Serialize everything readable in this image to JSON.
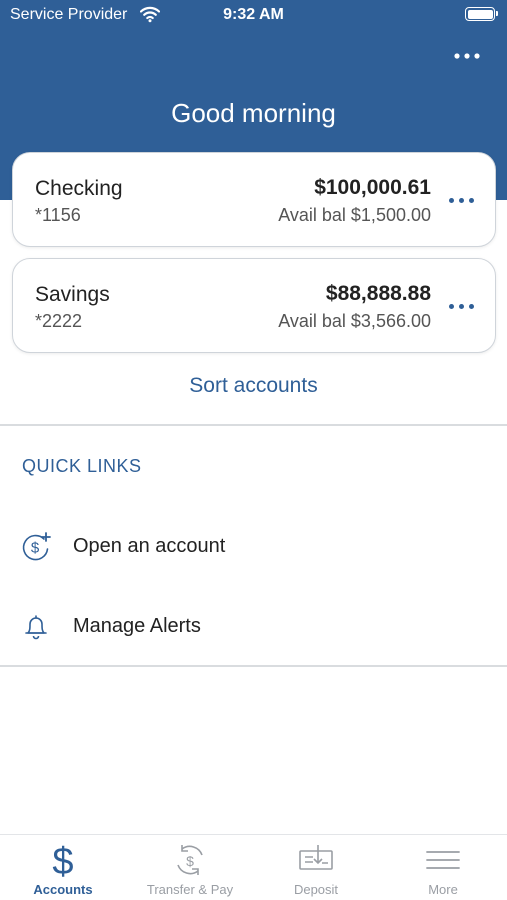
{
  "status_bar": {
    "carrier": "Service Provider",
    "time": "9:32 AM"
  },
  "header": {
    "greeting": "Good morning"
  },
  "accounts": [
    {
      "name": "Checking",
      "number": "*1156",
      "balance": "$100,000.61",
      "avail": "Avail bal $1,500.00"
    },
    {
      "name": "Savings",
      "number": "*2222",
      "balance": "$88,888.88",
      "avail": "Avail bal $3,566.00"
    }
  ],
  "sort_label": "Sort accounts",
  "quick_links": {
    "title": "QUICK LINKS",
    "items": [
      {
        "label": "Open an account",
        "icon": "dollar-plus-icon"
      },
      {
        "label": "Manage Alerts",
        "icon": "bell-icon"
      }
    ]
  },
  "tab_bar": {
    "tabs": [
      {
        "label": "Accounts",
        "icon": "dollar-icon",
        "active": true
      },
      {
        "label": "Transfer & Pay",
        "icon": "transfer-icon",
        "active": false
      },
      {
        "label": "Deposit",
        "icon": "check-deposit-icon",
        "active": false
      },
      {
        "label": "More",
        "icon": "menu-icon",
        "active": false
      }
    ]
  },
  "colors": {
    "brand": "#2f5f97",
    "inactive_tab": "#9a9ea4"
  }
}
